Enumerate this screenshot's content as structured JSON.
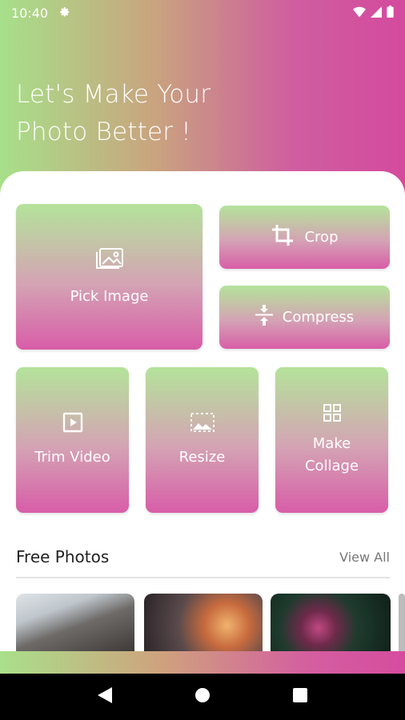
{
  "status_bar": {
    "time": "10:40",
    "settings_icon": "gear-icon",
    "wifi_icon": "wifi-icon",
    "signal_icon": "signal-icon",
    "battery_icon": "battery-icon"
  },
  "header": {
    "line1": "Let's Make Your",
    "line2": "Photo Better !"
  },
  "tools": {
    "pick_image": {
      "label": "Pick Image",
      "icon": "image-icon"
    },
    "crop": {
      "label": "Crop",
      "icon": "crop-icon"
    },
    "compress": {
      "label": "Compress",
      "icon": "compress-icon"
    },
    "trim_video": {
      "label": "Trim Video",
      "icon": "video-play-icon"
    },
    "resize": {
      "label": "Resize",
      "icon": "resize-icon"
    },
    "make_collage_line1": "Make",
    "make_collage_line2": "Collage"
  },
  "free_photos": {
    "title": "Free Photos",
    "view_all": "View All"
  },
  "nav": {
    "back": "back-icon",
    "home": "home-icon",
    "recents": "recents-icon"
  },
  "colors": {
    "gradient_start": "#a7e08a",
    "gradient_end": "#d44a9e"
  }
}
